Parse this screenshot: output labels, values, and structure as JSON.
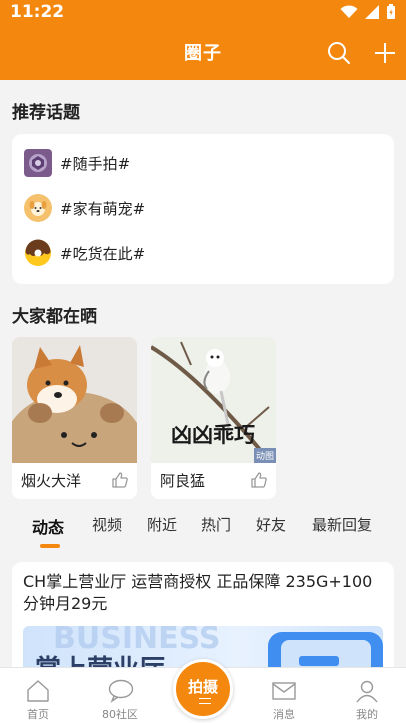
{
  "status_bar": {
    "time": "11:22"
  },
  "header": {
    "title": "圈子"
  },
  "topics": {
    "title": "推荐话题",
    "items": [
      {
        "label": "#随手拍#",
        "icon": "camera-aperture-icon"
      },
      {
        "label": "#家有萌宠#",
        "icon": "pet-dog-icon"
      },
      {
        "label": "#吃货在此#",
        "icon": "donut-icon"
      }
    ]
  },
  "gallery": {
    "title": "大家都在晒",
    "items": [
      {
        "name": "烟火大洋"
      },
      {
        "name": "阿良猛",
        "overlay_text": "凶凶乖巧",
        "badge": "动图"
      }
    ]
  },
  "tabs": [
    "动态",
    "视频",
    "附近",
    "热门",
    "好友",
    "最新回复"
  ],
  "post": {
    "text": "CH掌上营业厅 运营商授权 正品保障 235G+100分钟月29元",
    "banner_big": "掌上营业厅",
    "banner_watermark": "BUSINESS"
  },
  "bottom_nav": {
    "home": "首页",
    "community": "80社区",
    "shoot": "拍摄",
    "messages": "消息",
    "mine": "我的"
  },
  "colors": {
    "accent": "#f4880f",
    "background": "#f3f3f3"
  }
}
